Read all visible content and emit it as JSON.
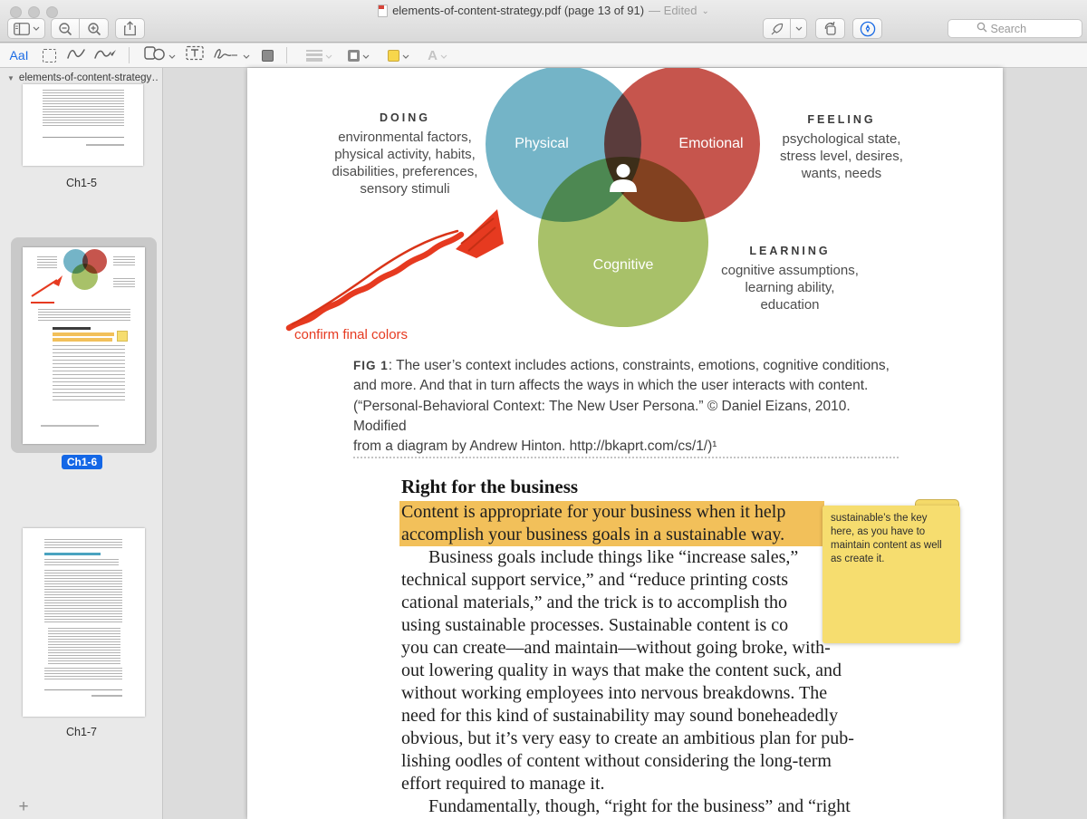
{
  "window": {
    "title": "elements-of-content-strategy.pdf (page 13 of 91)",
    "status": "— Edited"
  },
  "toolbar": {
    "search_placeholder": "Search"
  },
  "markup": {
    "aa_label": "AaI",
    "a_label": "A",
    "accent_color": "#1b6be4",
    "fill_swatch_color": "#f7d64b"
  },
  "sidebar": {
    "document_title": "elements-of-content-strategy…",
    "thumbnails": [
      {
        "label": "Ch1-5"
      },
      {
        "label": "Ch1-6"
      },
      {
        "label": "Ch1-7"
      }
    ],
    "selected_label_color": "#1467e6",
    "add_label": "+"
  },
  "page": {
    "venn": {
      "circles": [
        {
          "label": "Physical",
          "color": "#74b4c7"
        },
        {
          "label": "Emotional",
          "color": "#c6554d"
        },
        {
          "label": "Cognitive",
          "color": "#a8c169"
        }
      ],
      "groups": [
        {
          "title": "DOING",
          "lines": [
            "environmental factors,",
            "physical activity, habits,",
            "disabilities, preferences,",
            "sensory stimuli"
          ]
        },
        {
          "title": "FEELING",
          "lines": [
            "psychological state,",
            "stress level, desires,",
            "wants, needs"
          ]
        },
        {
          "title": "LEARNING",
          "lines": [
            "cognitive assumptions,",
            "learning ability,",
            "education"
          ]
        }
      ]
    },
    "annotation": {
      "arrow_label": "confirm final colors",
      "color": "#e63a20"
    },
    "caption": {
      "fig_label": "FIG 1",
      "line1_rest": ": The user’s context includes actions, constraints, emotions, cognitive conditions,",
      "line2": "and more. And that in turn affects the ways in which the user interacts with content.",
      "line3": "(“Personal-Behavioral Context: The New User Persona.” © Daniel Eizans, 2010. Modified",
      "line4": "from a diagram by Andrew Hinton. http://bkaprt.com/cs/1/)¹"
    },
    "article": {
      "heading": "Right for the business",
      "highlight_color": "#f2c05a",
      "lines": [
        "Content is appropriate for your business when it help",
        "accomplish your business goals in a sustainable way.",
        "Business goals include things like “increase sales,”",
        "technical support service,” and “reduce printing costs",
        "cational materials,” and the trick is to accomplish tho",
        "using sustainable processes. Sustainable content is co",
        "you can create—and maintain—without going broke, with-",
        "out lowering quality in ways that make the content suck, and",
        "without working employees into nervous breakdowns. The",
        "need for this kind of sustainability may sound boneheadedly",
        "obvious, but it’s very easy to create an ambitious plan for pub-",
        "lishing oodles of content without considering the long-term",
        "effort required to manage it.",
        "Fundamentally, though, “right for the business” and “right"
      ]
    },
    "note": {
      "text": "sustainable’s the key here, as you have to maintain content as well as create it.",
      "color": "#f6dd6f"
    }
  }
}
